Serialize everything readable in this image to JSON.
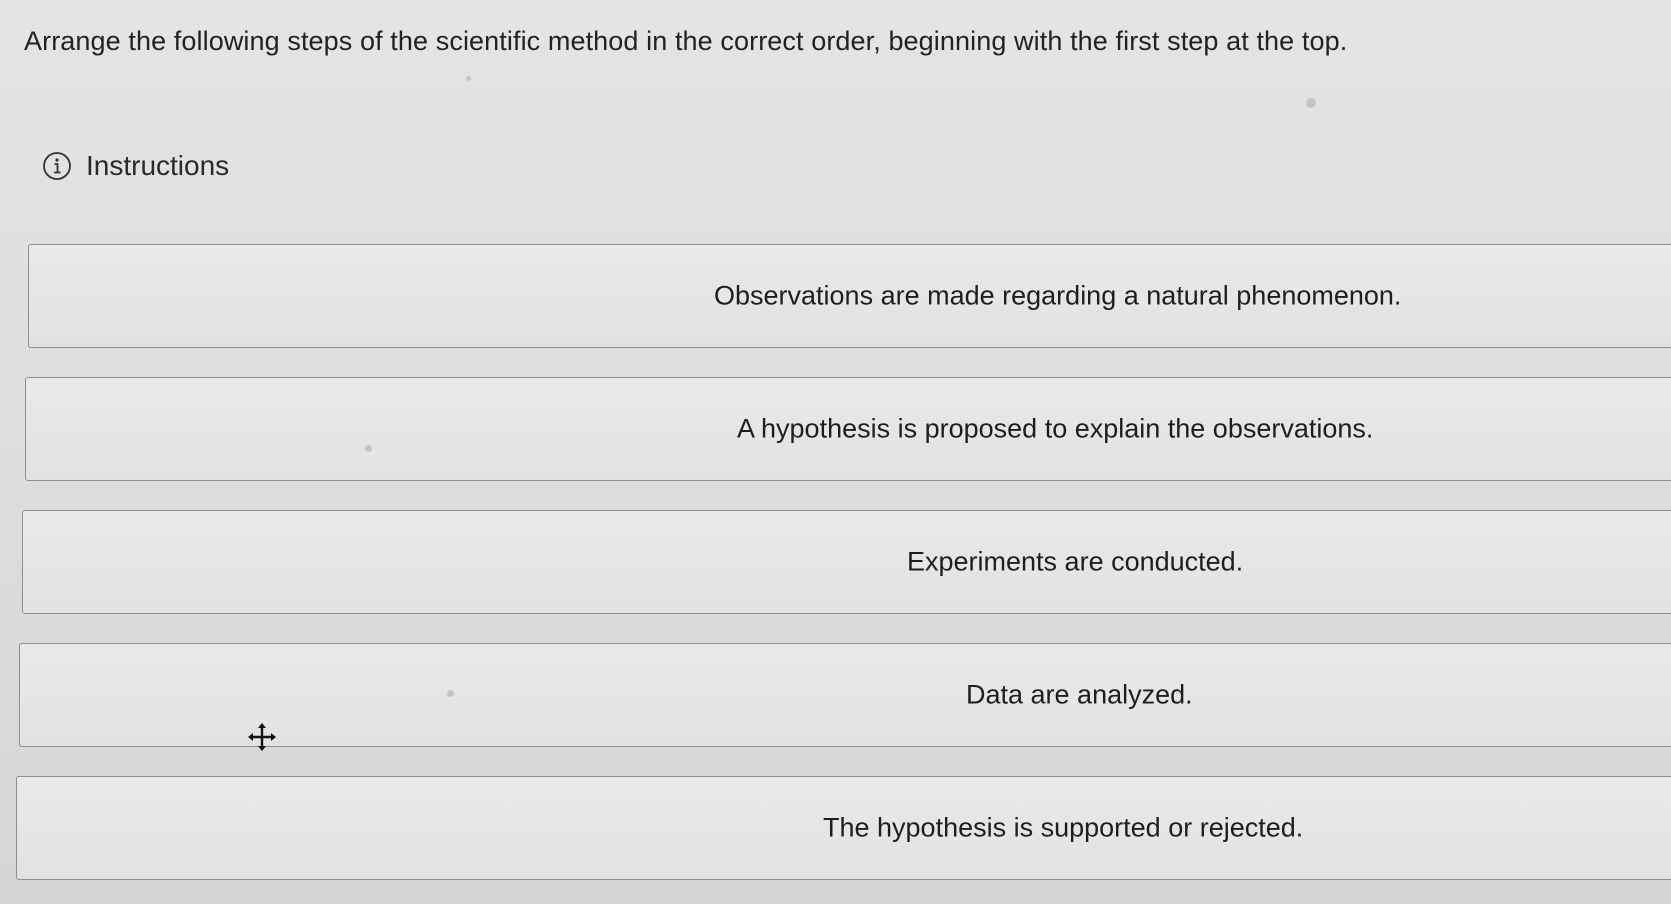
{
  "prompt": "Arrange the following steps of the scientific method in the correct order, beginning with the first step at the top.",
  "instructions": {
    "label": "Instructions",
    "icon": "info-icon"
  },
  "steps": [
    {
      "text": "Observations are made regarding a natural phenomenon."
    },
    {
      "text": "A hypothesis is proposed to explain the observations."
    },
    {
      "text": "Experiments are conducted."
    },
    {
      "text": "Data are analyzed."
    },
    {
      "text": "The hypothesis is supported or rejected."
    }
  ],
  "cursor": {
    "icon": "move-cursor-icon"
  },
  "colors": {
    "background": "#dcdcda",
    "card_border": "#8f8f8f",
    "text": "#1e1e1e"
  }
}
